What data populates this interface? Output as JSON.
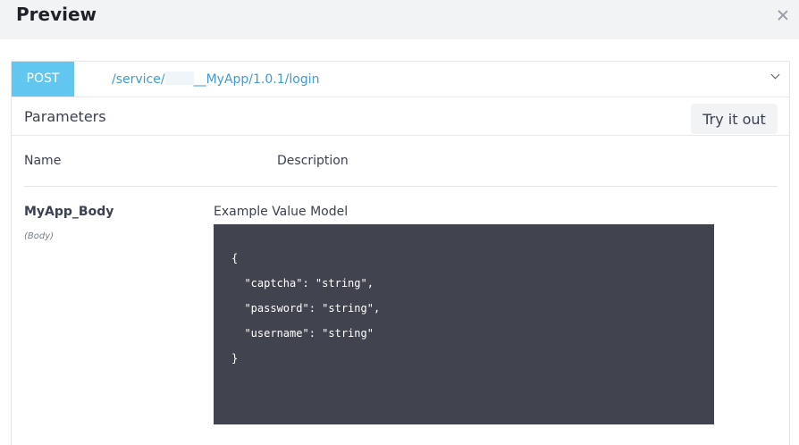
{
  "dialog": {
    "title": "Preview"
  },
  "operation": {
    "method": "POST",
    "path_prefix": "/service/",
    "path_suffix": "__MyApp/1.0.1/login"
  },
  "parameters": {
    "title": "Parameters",
    "try_label": "Try it out",
    "columns": {
      "name": "Name",
      "description": "Description"
    },
    "param": {
      "name": "MyApp_Body",
      "in": "(Body)",
      "example_label": "Example Value Model",
      "example_code": "{\n  \"captcha\": \"string\",\n  \"password\": \"string\",\n  \"username\": \"string\"\n}"
    }
  },
  "icons": {
    "close": "close-icon",
    "expand": "chevron-down-icon"
  },
  "colors": {
    "method_badge": "#61c7f1",
    "path_link": "#3f9ad8",
    "code_background": "#41444e",
    "header_background": "#f2f3f5"
  }
}
